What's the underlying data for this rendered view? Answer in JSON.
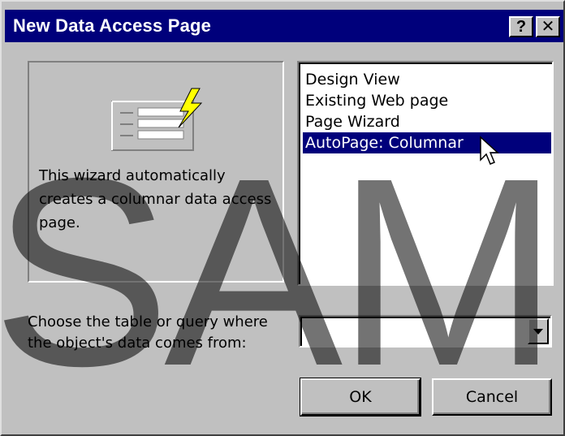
{
  "window": {
    "title": "New Data Access Page",
    "help_label": "?",
    "close_label": "✕"
  },
  "description": "This wizard automatically creates a columnar data access page.",
  "list": {
    "items": [
      {
        "label": "Design View",
        "selected": false
      },
      {
        "label": "Existing Web page",
        "selected": false
      },
      {
        "label": "Page Wizard",
        "selected": false
      },
      {
        "label": "AutoPage:  Columnar",
        "selected": true
      }
    ]
  },
  "source": {
    "label": "Choose the table or query where the object's data comes from:",
    "value": ""
  },
  "buttons": {
    "ok": "OK",
    "cancel": "Cancel"
  },
  "watermark": "SAMP",
  "colors": {
    "titlebar": "#00007b",
    "face": "#c0c0c0",
    "selection": "#00007b"
  }
}
